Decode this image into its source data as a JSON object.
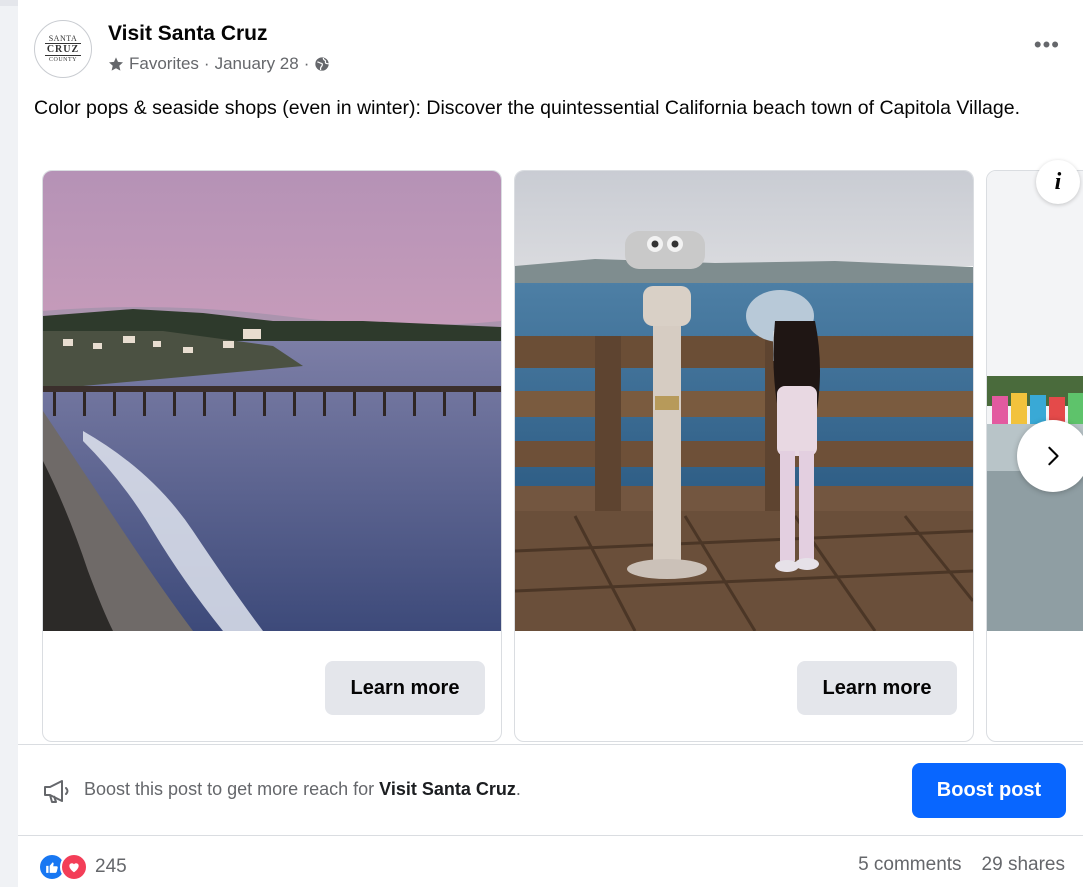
{
  "post": {
    "page_name": "Visit Santa Cruz",
    "avatar_text": [
      "SANTA",
      "CRUZ",
      "COUNTY"
    ],
    "audience": "Favorites",
    "separator": "·",
    "date": "January 28",
    "caption": "Color pops & seaside shops (even in winter): Discover the quintessential California beach town of Capitola Village.",
    "more_label": "•••"
  },
  "carousel": {
    "slides": [
      {
        "photo": "capitola-pier-sunset",
        "cta": "Learn more"
      },
      {
        "photo": "child-at-pier-binoculars",
        "cta": "Learn more"
      },
      {
        "photo": "colorful-capitola-houses"
      }
    ],
    "info_label": "i"
  },
  "boost": {
    "text_prefix": "Boost this post to get more reach for ",
    "text_name": "Visit Santa Cruz",
    "text_suffix": ".",
    "button": "Boost post"
  },
  "engagement": {
    "reaction_count": "245",
    "comments": "5 comments",
    "shares": "29 shares"
  },
  "colors": {
    "accent": "#0866ff",
    "like": "#1877f2",
    "love": "#f33e58",
    "muted_text": "#65676b"
  },
  "icons": [
    "star-icon",
    "globe-icon",
    "more-icon",
    "info-icon",
    "chevron-right-icon",
    "megaphone-icon",
    "like-icon",
    "love-icon"
  ]
}
